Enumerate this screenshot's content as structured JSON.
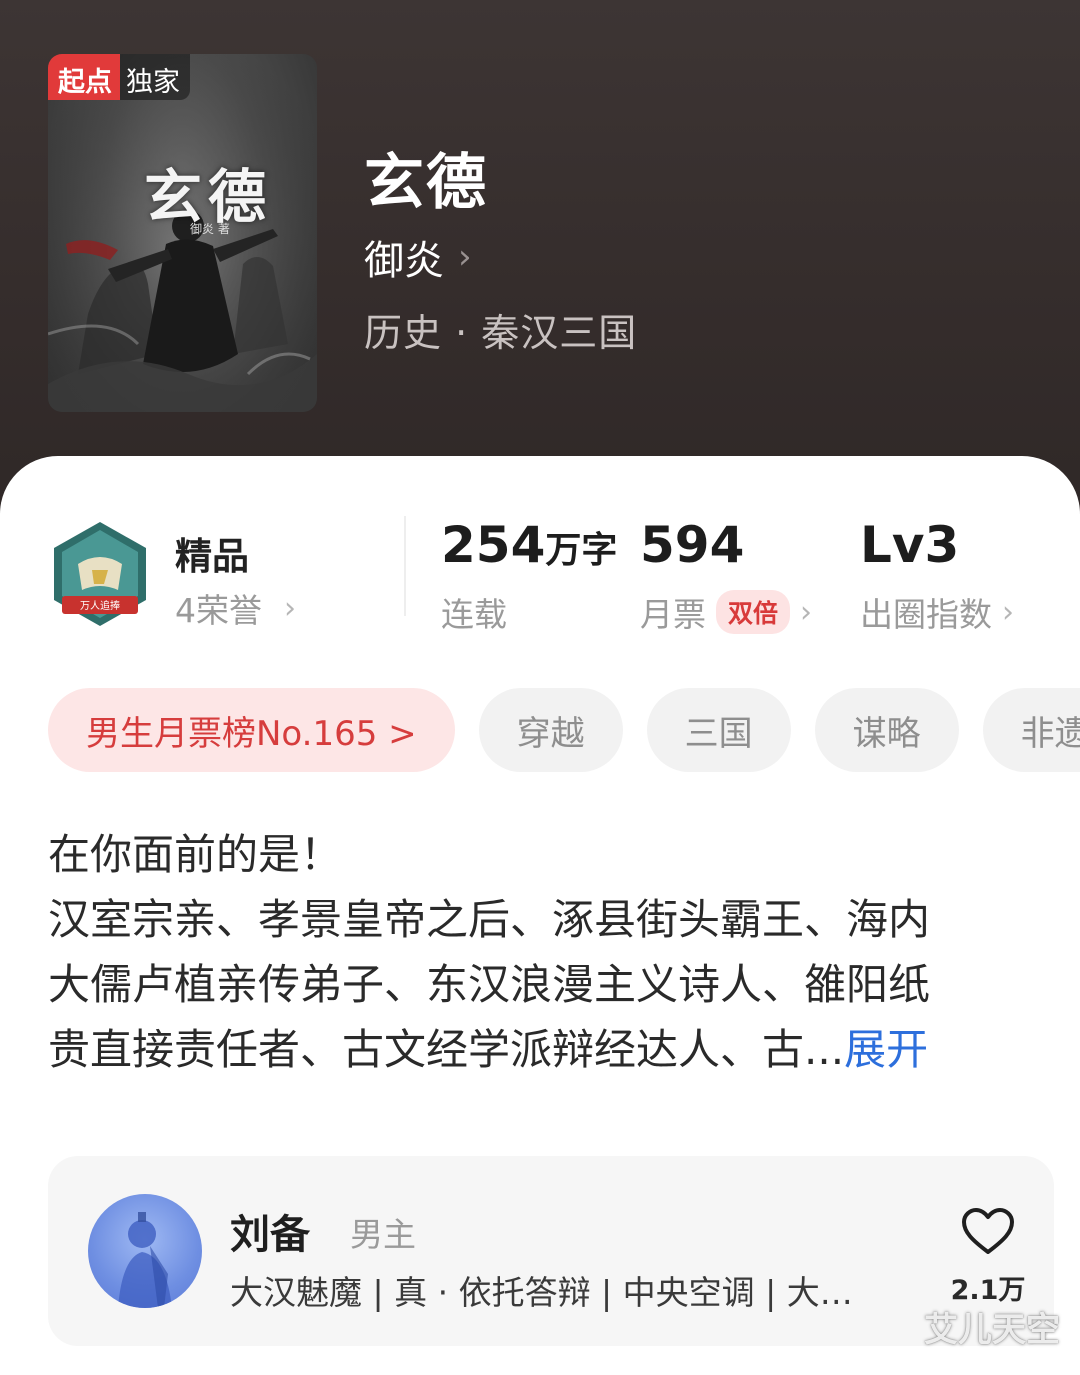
{
  "cover": {
    "brand_label": "起点",
    "exclusive_label": "独家",
    "title_art": "玄德",
    "author_art": "御炎 著"
  },
  "book": {
    "title": "玄德",
    "author": "御炎",
    "genre": "历史 · 秦汉三国"
  },
  "honor": {
    "badge_text": "万人追捧",
    "title": "精品",
    "subtitle": "4荣誉"
  },
  "stats": {
    "word_count": "254",
    "word_unit": "万字",
    "status": "连载",
    "monthly_tickets": "594",
    "monthly_label": "月票",
    "double_label": "双倍",
    "level": "Lv3",
    "level_label": "出圈指数"
  },
  "tags": [
    "男生月票榜No.165 >",
    "穿越",
    "三国",
    "谋略",
    "非遗"
  ],
  "synopsis": {
    "line1": "在你面前的是！",
    "line2": "汉室宗亲、孝景皇帝之后、涿县街头霸王、海内",
    "line3": "大儒卢植亲传弟子、东汉浪漫主义诗人、雒阳纸",
    "line4": "贵直接责任者、古文经学派辩经达人、古...",
    "expand": "展开"
  },
  "character": {
    "name": "刘备",
    "role": "男主",
    "desc": "大汉魅魔 | 真 · 依托答辩 | 中央空调 | 大…",
    "likes": "2.1万"
  },
  "watermark": "艾儿天空",
  "colors": {
    "header_bg": "#352d2c",
    "accent_red": "#d63d3d",
    "tag_red_bg": "#fde6e6",
    "link_blue": "#2d6fdc",
    "brand_red": "#e13a3a"
  },
  "icons": [
    "chevron-right-icon",
    "heart-icon",
    "honor-badge-icon"
  ]
}
